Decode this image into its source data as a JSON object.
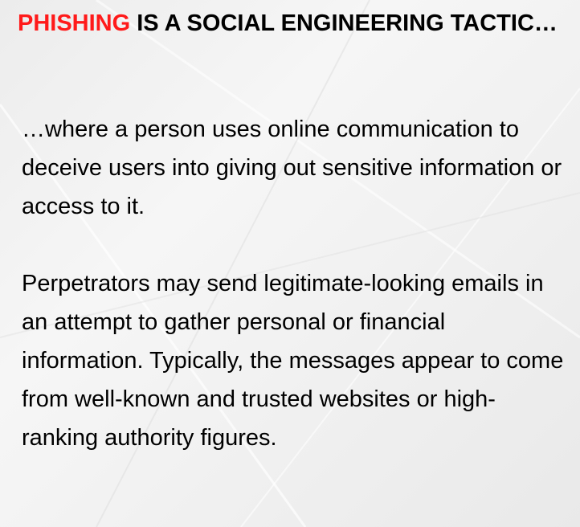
{
  "title": {
    "highlight": "PHISHING",
    "rest": " IS A SOCIAL ENGINEERING TACTIC…"
  },
  "colors": {
    "highlight": "#ff1a1a",
    "text": "#000000"
  },
  "paragraphs": [
    "…where a person uses online communication to deceive users into giving out sensitive information or access to it.",
    "Perpetrators may send legitimate-looking emails in an attempt to gather personal or financial information. Typically, the messages appear to come from well-known and trusted websites or high-ranking authority figures."
  ]
}
